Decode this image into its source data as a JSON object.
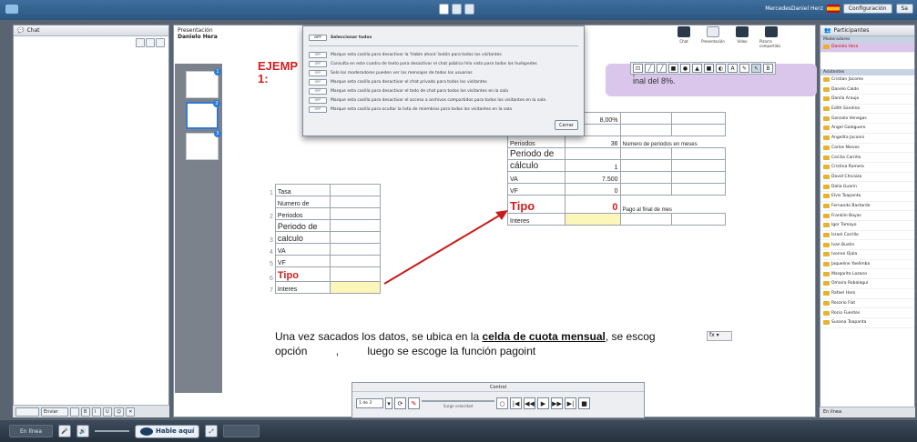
{
  "topbar": {
    "user": "MercedesDaniel Herz",
    "settings": "Configuración",
    "extra": "Sa"
  },
  "chat": {
    "title": "Chat",
    "font_size": "Enviar"
  },
  "presentation": {
    "title": "Presentación",
    "presenter": "Danielo Hera",
    "slide_title_l1": "EJEMP",
    "slide_title_l2": "1:",
    "callout_l1": "préstam",
    "callout_l2": "inal del 8%.",
    "view_buttons": [
      "Chat",
      "Presentación",
      "Video",
      "Pizarra compartida"
    ],
    "thumb_badges": [
      "1",
      "2",
      "3"
    ]
  },
  "draw_tools": [
    "⊡",
    "╱",
    "╱",
    "■",
    "●",
    "▲",
    "■",
    "◐",
    "A",
    "✎",
    "↖",
    "B"
  ],
  "left_table": {
    "rows": [
      {
        "n": "1",
        "label": "Tasa"
      },
      {
        "n": "",
        "label": "Numero de"
      },
      {
        "n": "2",
        "label": "Periodos"
      },
      {
        "n": "",
        "label": "Periodo de"
      },
      {
        "n": "3",
        "label": "calculo"
      },
      {
        "n": "4",
        "label": "VA"
      },
      {
        "n": "5",
        "label": "VF"
      },
      {
        "n": "6",
        "label": "Tipo"
      },
      {
        "n": "7",
        "label": "Interes"
      }
    ]
  },
  "right_table": {
    "rate": "8,00%",
    "periods_label": "Periodos",
    "periods_value": "36",
    "periods_note": "Numero de periodos en meses",
    "calc_l1": "Periodo de",
    "calc_l2": "cálculo",
    "calc_value": "1",
    "va_label": "VA",
    "va_value": "7.500",
    "vf_label": "VF",
    "vf_value": "0",
    "tipo_label": "Tipo",
    "tipo_value": "0",
    "tipo_note": "Pago al final de mes",
    "interes_label": "Interes"
  },
  "caption": {
    "before": "Una vez sacados los datos, se ubica en la ",
    "highlight": "celda de cuota mensual",
    "after": ", se escog",
    "line2_a": "opción",
    "line2_b": ",",
    "line2_c": "luego se escoge la función pagoint",
    "fx": "fx ▾"
  },
  "dialog": {
    "select_all": "Seleccionar todos",
    "items": [
      "Marque esta casilla para desactivar la 'Hable ahora' botón para todos los visitantes",
      "Consulta en este cuadro de texto para desactivar el chat público hilo visto para todos los huéspedes",
      "Solo los moderadores pueden ver los mensajes de todos los usuarios",
      "Marque esta casilla para desactivar el chat privado para todos los visitantes",
      "Marque esta casilla para desactivar el todo de chat para todos los visitantes en la sala",
      "Marque esta casilla para desactivar el acceso a archivos compartidos para todos los visitantes en la sala",
      "Marque esta casilla para ocultar la lista de miembros para todos los visitantes en la sala"
    ],
    "switch": "OFF",
    "close": "Cerrar"
  },
  "control": {
    "title": "Control",
    "page": "1 de 3",
    "speed": "Surge velocidad",
    "buttons": [
      "○",
      "|◀",
      "◀◀",
      "▶",
      "▶▶",
      "▶|",
      "■"
    ]
  },
  "participants": {
    "title": "Participantes",
    "mod_section": "Moderadores",
    "me": "Danielo Hera",
    "att_section": "Asistentes",
    "people": [
      "Cristian Jacome",
      "Danelo Caldo",
      "Danila Araujo",
      "Edith Sandino",
      "Gonzalo Venegas",
      "Angel Galeguero",
      "Angelita Jaconni",
      "Carlos Nieves",
      "Cecilia Carrillo",
      "Cristina Romero",
      "David Chicaiza",
      "Dalia Guarin",
      "Elvis Toapanta",
      "Fernando Bastarde",
      "Franklin Boyas",
      "Igor Tamayo",
      "Israel Carrillo",
      "Ivan Bustin",
      "Ivonne Ojala",
      "Jaqueline Yaelimba",
      "Margarita Lozano",
      "Omaira Robalaguí",
      "Rafael Haro",
      "Rosario Fiat",
      "Rocio Fuentes",
      "Susana Toapanta"
    ],
    "footer": "En línea"
  },
  "bottombar": {
    "talk": "Hable aquí",
    "status": "En línea"
  }
}
